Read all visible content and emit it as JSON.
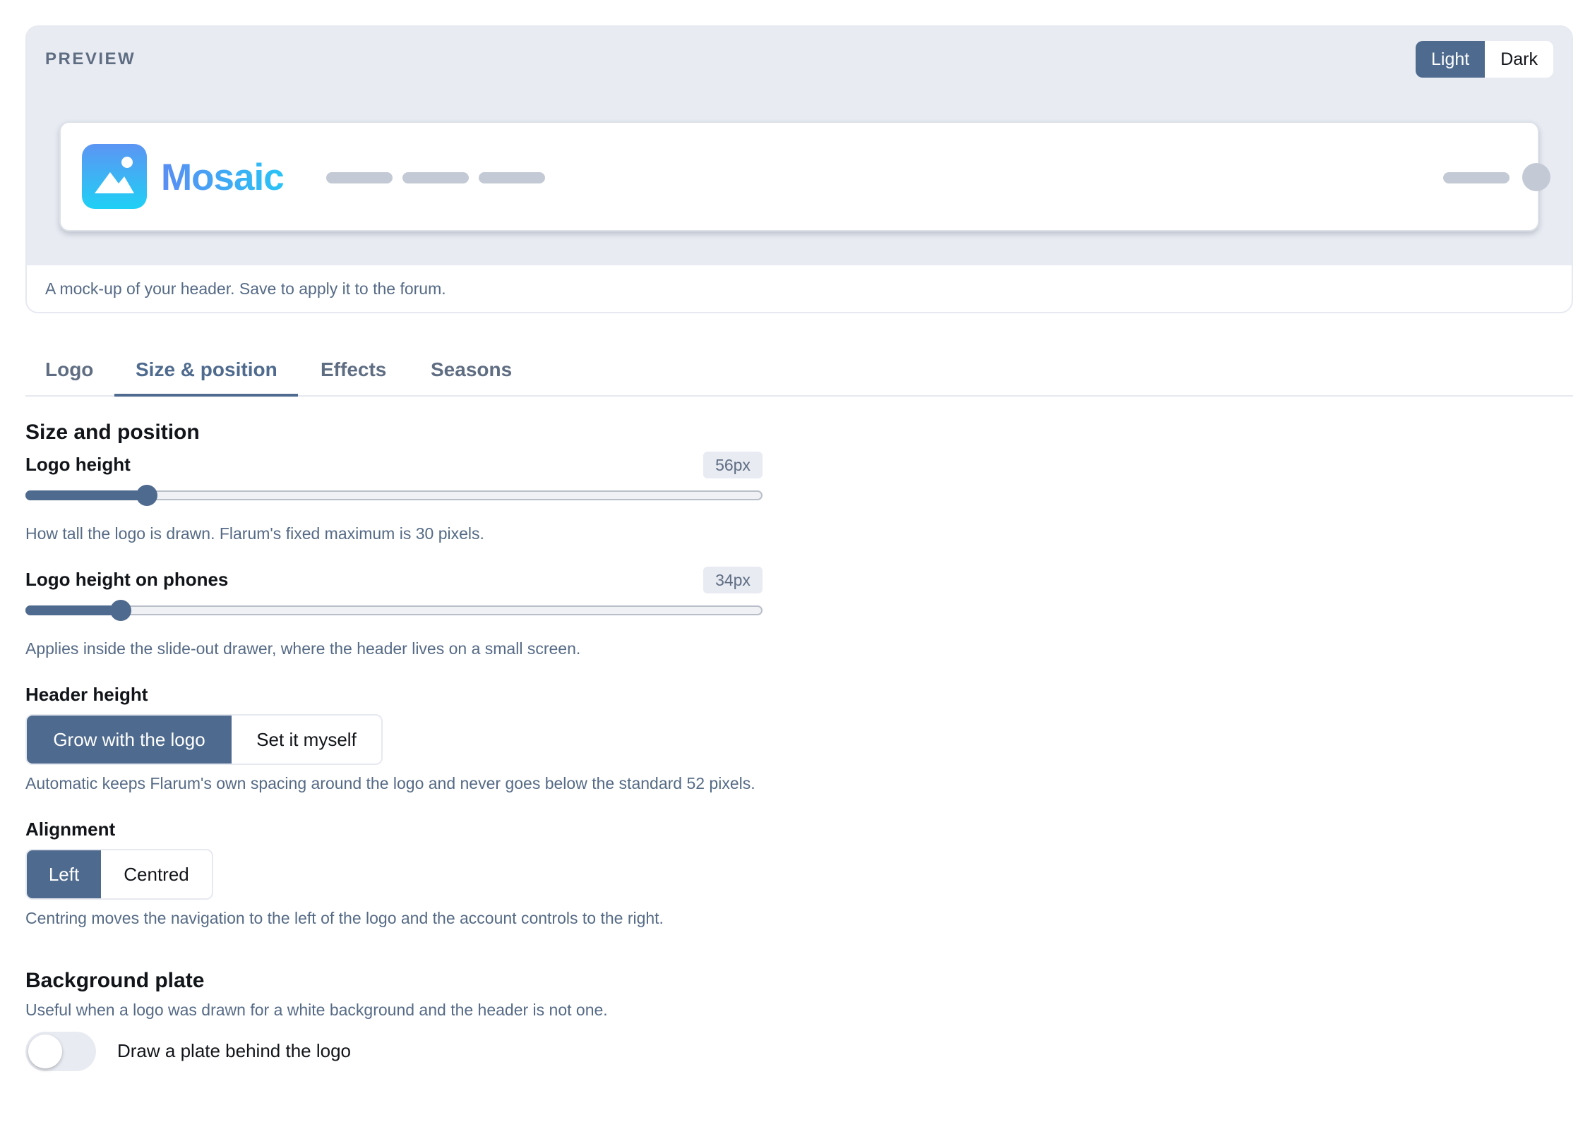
{
  "preview": {
    "label": "PREVIEW",
    "mode_light": "Light",
    "mode_dark": "Dark",
    "active_mode": "Light",
    "mock_wordmark": "Mosaic",
    "logo_icon": "image-mountain-icon",
    "caption": "A mock-up of your header. Save to apply it to the forum."
  },
  "tabs": [
    {
      "label": "Logo",
      "active": false
    },
    {
      "label": "Size & position",
      "active": true
    },
    {
      "label": "Effects",
      "active": false
    },
    {
      "label": "Seasons",
      "active": false
    }
  ],
  "size_position": {
    "title": "Size and position",
    "logo_height": {
      "label": "Logo height",
      "value_text": "56px",
      "fill_fraction": 0.165,
      "help": "How tall the logo is drawn. Flarum's fixed maximum is 30 pixels."
    },
    "logo_height_phones": {
      "label": "Logo height on phones",
      "value_text": "34px",
      "fill_fraction": 0.129,
      "help": "Applies inside the slide-out drawer, where the header lives on a small screen."
    },
    "header_height": {
      "label": "Header height",
      "options": [
        "Grow with the logo",
        "Set it myself"
      ],
      "selected": "Grow with the logo",
      "help": "Automatic keeps Flarum's own spacing around the logo and never goes below the standard 52 pixels."
    },
    "alignment": {
      "label": "Alignment",
      "options": [
        "Left",
        "Centred"
      ],
      "selected": "Left",
      "help": "Centring moves the navigation to the left of the logo and the account controls to the right."
    }
  },
  "background_plate": {
    "title": "Background plate",
    "help": "Useful when a logo was drawn for a white background and the header is not one.",
    "toggle_label": "Draw a plate behind the logo",
    "enabled": false
  },
  "colors": {
    "accent": "#4e6a8e",
    "muted_text": "#556a86",
    "stage_bg": "#e8ebf2"
  }
}
